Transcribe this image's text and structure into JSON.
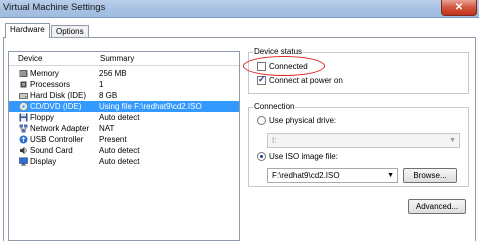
{
  "window": {
    "title": "Virtual Machine Settings",
    "close_glyph": "✕"
  },
  "tabs": [
    {
      "label": "Hardware",
      "active": true
    },
    {
      "label": "Options",
      "active": false
    }
  ],
  "device_list": {
    "columns": [
      "Device",
      "Summary"
    ],
    "selected_index": 3,
    "rows": [
      {
        "device": "Memory",
        "summary": "256 MB",
        "icon": "memory-icon"
      },
      {
        "device": "Processors",
        "summary": "1",
        "icon": "processor-icon"
      },
      {
        "device": "Hard Disk (IDE)",
        "summary": "8 GB",
        "icon": "hard-disk-icon"
      },
      {
        "device": "CD/DVD (IDE)",
        "summary": "Using file F:\\redhat9\\cd2.ISO",
        "icon": "cd-dvd-icon"
      },
      {
        "device": "Floppy",
        "summary": "Auto detect",
        "icon": "floppy-icon"
      },
      {
        "device": "Network Adapter",
        "summary": "NAT",
        "icon": "network-adapter-icon"
      },
      {
        "device": "USB Controller",
        "summary": "Present",
        "icon": "usb-icon"
      },
      {
        "device": "Sound Card",
        "summary": "Auto detect",
        "icon": "sound-card-icon"
      },
      {
        "device": "Display",
        "summary": "Auto detect",
        "icon": "display-icon"
      }
    ]
  },
  "device_status": {
    "label": "Device status",
    "connected": {
      "label": "Connected",
      "checked": false
    },
    "connect_at_power_on": {
      "label": "Connect at power on",
      "checked": true
    }
  },
  "connection": {
    "label": "Connection",
    "physical": {
      "label": "Use physical drive:",
      "selected": false,
      "value": "I:"
    },
    "iso": {
      "label": "Use ISO image file:",
      "selected": true,
      "value": "F:\\redhat9\\cd2.ISO"
    },
    "browse_label": "Browse..."
  },
  "advanced_label": "Advanced...",
  "colors": {
    "selection": "#3399ff",
    "highlight_circle": "#dd2222",
    "titlebar": "#a6c1e3"
  }
}
